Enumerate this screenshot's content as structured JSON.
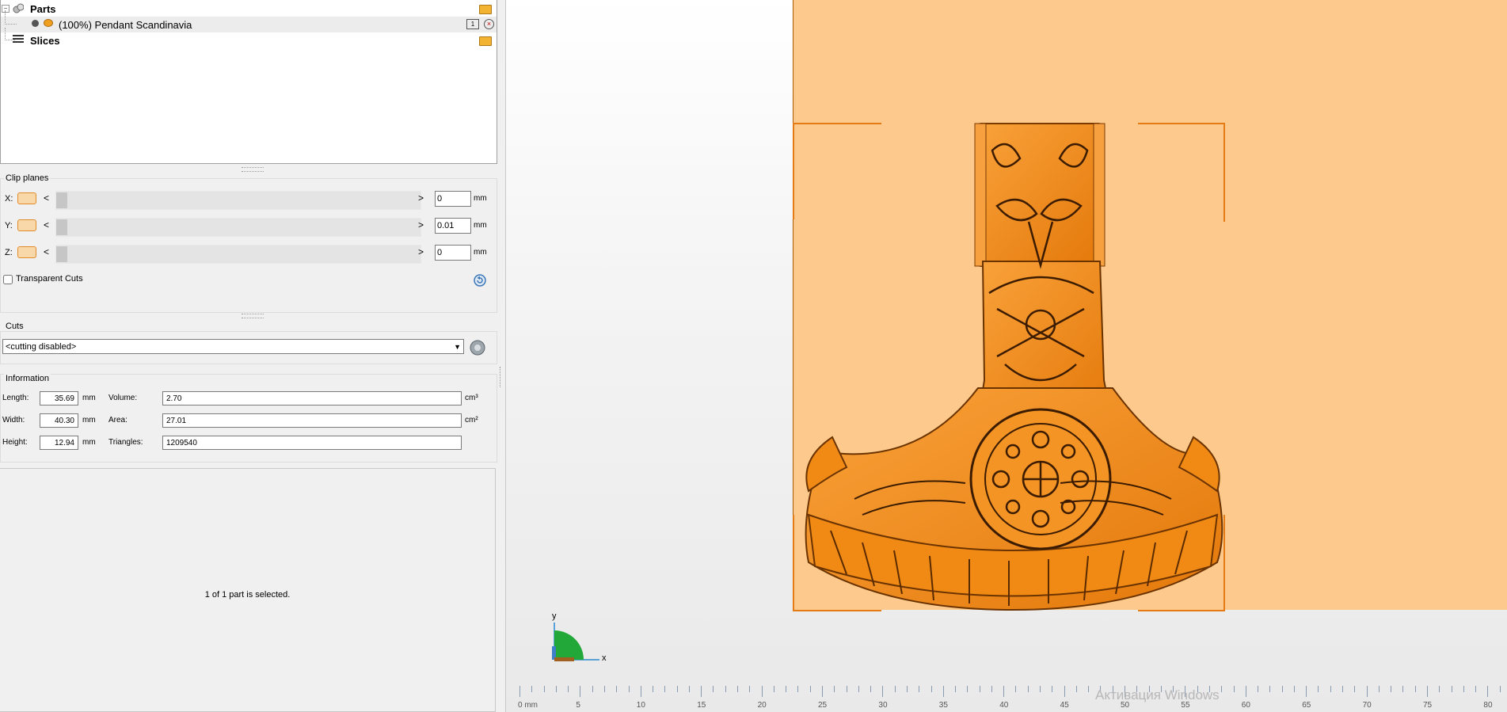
{
  "tree": {
    "parts_label": "Parts",
    "part_item_label": "(100%) Pendant Scandinavia",
    "part_item_badge": "1",
    "slices_label": "Slices"
  },
  "clip_planes": {
    "title": "Clip planes",
    "rows": [
      {
        "axis": "X:",
        "value": "0",
        "unit": "mm"
      },
      {
        "axis": "Y:",
        "value": "0.01",
        "unit": "mm"
      },
      {
        "axis": "Z:",
        "value": "0",
        "unit": "mm"
      }
    ],
    "left_arrow": "<",
    "right_arrow": ">",
    "transparent_cuts_label": "Transparent Cuts",
    "transparent_cuts_checked": false
  },
  "cuts": {
    "title": "Cuts",
    "selected": "<cutting disabled>"
  },
  "information": {
    "title": "Information",
    "length_label": "Length:",
    "length_value": "35.69",
    "width_label": "Width:",
    "width_value": "40.30",
    "height_label": "Height:",
    "height_value": "12.94",
    "dim_unit": "mm",
    "volume_label": "Volume:",
    "volume_value": "2.70",
    "volume_unit": "cm³",
    "area_label": "Area:",
    "area_value": "27.01",
    "area_unit": "cm²",
    "triangles_label": "Triangles:",
    "triangles_value": "1209540"
  },
  "status": {
    "selection_text": "1 of 1 part is selected."
  },
  "viewport": {
    "axis_y": "y",
    "axis_x": "x",
    "ruler_labels": [
      "0 mm",
      "5",
      "10",
      "15",
      "20",
      "25",
      "30",
      "35",
      "40",
      "45",
      "50",
      "55",
      "60",
      "65",
      "70",
      "75",
      "80"
    ],
    "watermark": "Активация Windows",
    "model_color": "#f28a12",
    "plate_color": "#fdc98c"
  }
}
